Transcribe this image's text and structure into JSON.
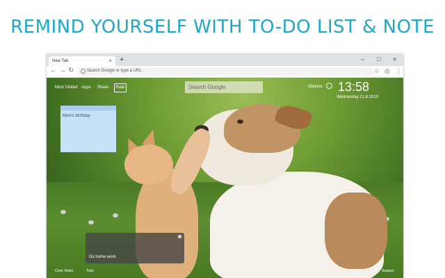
{
  "headline": "REMIND YOURSELF WITH TO-DO LIST & NOTE",
  "browser": {
    "tab_label": "New Tab",
    "tab_close": "×",
    "new_tab": "+",
    "window_controls": {
      "minimize": "–",
      "maximize": "□",
      "close": "×"
    },
    "nav": {
      "back": "←",
      "forward": "→",
      "reload": "↻"
    },
    "omnibox_placeholder": "Search Google or type a URL",
    "toolbar_icons": {
      "star": "☆",
      "profile": "◎",
      "menu": "⋮"
    }
  },
  "page": {
    "top_nav": [
      "Most Visited",
      "Apps",
      "Share",
      "Rate"
    ],
    "search_placeholder": "Search Google",
    "options_label": "Options",
    "clock_time": "13:58",
    "clock_date": "Wednesday  21.8.2019",
    "sticky_note": "Mimi's birthday",
    "todo_item": "Do home work",
    "bottom": {
      "clear_notes": "Clear Notes",
      "todo": "Todo",
      "support": "Support"
    }
  }
}
